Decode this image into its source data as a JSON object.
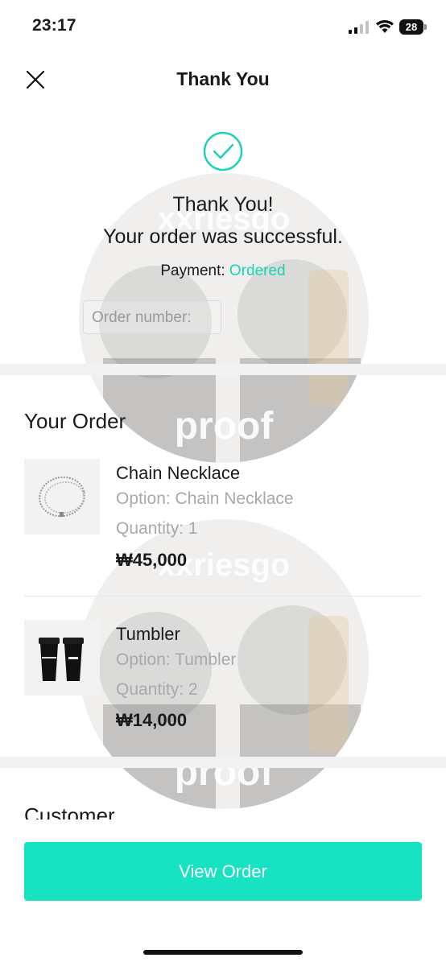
{
  "status_bar": {
    "time": "23:17",
    "battery": "28"
  },
  "nav": {
    "title": "Thank You"
  },
  "confirmation": {
    "line1": "Thank You!",
    "line2": "Your order was successful.",
    "payment_label": "Payment:",
    "payment_status": "Ordered",
    "order_number_placeholder": "Order number:"
  },
  "order": {
    "heading": "Your Order",
    "items": [
      {
        "name": "Chain Necklace",
        "option": "Option: Chain Necklace",
        "quantity": "Quantity: 1",
        "price": "₩45,000",
        "thumbnail": "necklace-image"
      },
      {
        "name": "Tumbler",
        "option": "Option: Tumbler",
        "quantity": "Quantity: 2",
        "price": "₩14,000",
        "thumbnail": "tumbler-image"
      }
    ]
  },
  "customer": {
    "heading": "Customer"
  },
  "actions": {
    "view_order": "View Order"
  },
  "watermark": {
    "text_top": "xxriesgo",
    "text_bottom": "proof"
  },
  "colors": {
    "accent": "#18d4b4",
    "button": "#17e2c1",
    "muted_text": "#a8a8ae"
  }
}
